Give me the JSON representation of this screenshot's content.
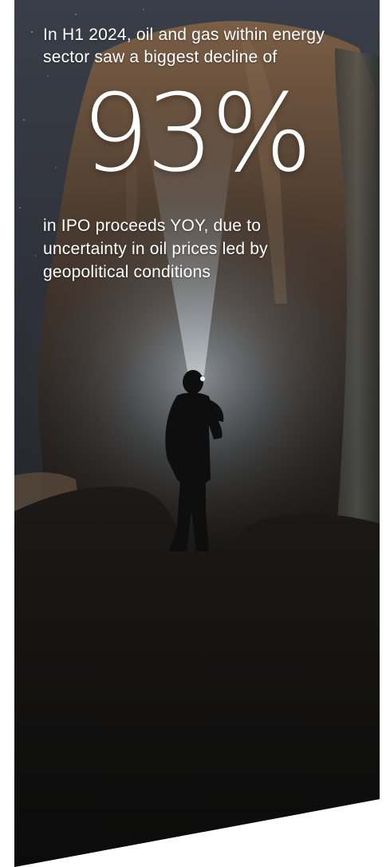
{
  "stat": {
    "intro": "In H1 2024, oil and gas within energy sector saw a biggest decline of",
    "value": "93%",
    "outro": "in IPO proceeds YOY, due to uncertainty in oil prices led by geopolitical conditions"
  },
  "background": {
    "sky_color": "#2a2f3a",
    "cliff_color": "#5c4a3a",
    "beam_color": "#d8e6f2",
    "ground_color": "#121212"
  }
}
